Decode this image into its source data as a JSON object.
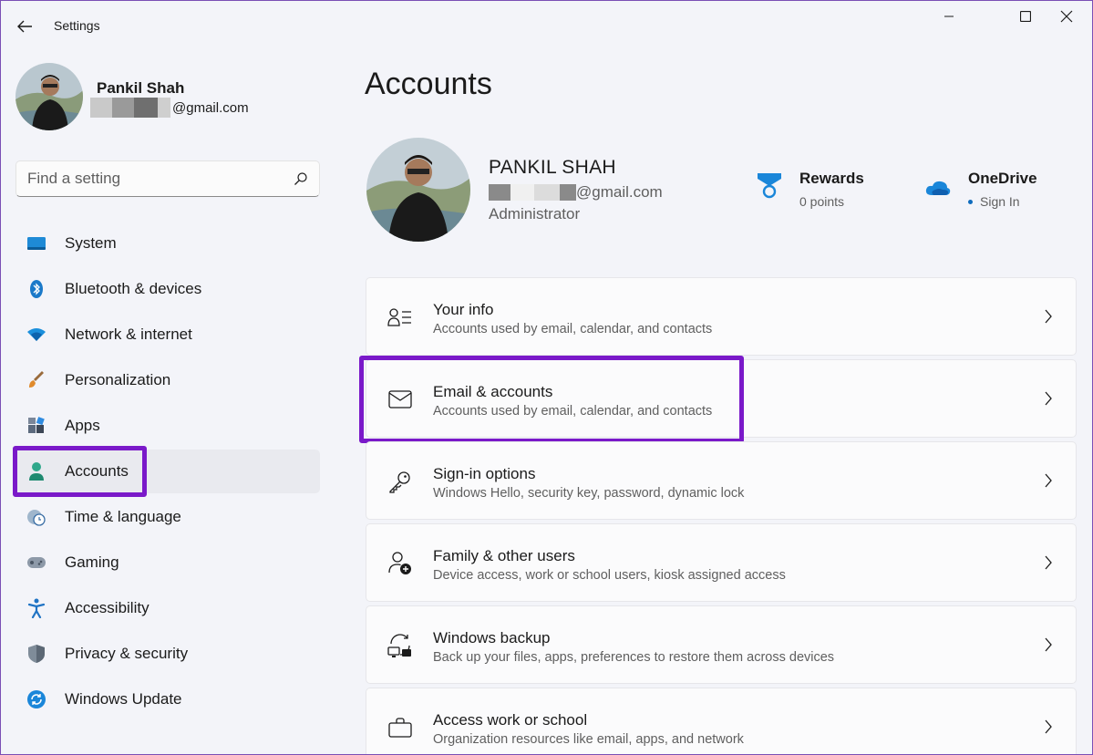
{
  "window": {
    "title": "Settings"
  },
  "profile": {
    "name": "Pankil Shah",
    "email": "@gmail.com"
  },
  "search": {
    "placeholder": "Find a setting"
  },
  "nav": {
    "items": [
      {
        "label": "System",
        "icon": "monitor-icon"
      },
      {
        "label": "Bluetooth & devices",
        "icon": "bluetooth-icon"
      },
      {
        "label": "Network & internet",
        "icon": "wifi-icon"
      },
      {
        "label": "Personalization",
        "icon": "paintbrush-icon"
      },
      {
        "label": "Apps",
        "icon": "apps-icon"
      },
      {
        "label": "Accounts",
        "icon": "person-icon",
        "active": true
      },
      {
        "label": "Time & language",
        "icon": "clock-globe-icon"
      },
      {
        "label": "Gaming",
        "icon": "gamepad-icon"
      },
      {
        "label": "Accessibility",
        "icon": "accessibility-icon"
      },
      {
        "label": "Privacy & security",
        "icon": "shield-icon"
      },
      {
        "label": "Windows Update",
        "icon": "update-icon"
      }
    ]
  },
  "main": {
    "title": "Accounts",
    "account": {
      "name": "PANKIL SHAH",
      "email": "@gmail.com",
      "role": "Administrator"
    },
    "rewards": {
      "title": "Rewards",
      "subtitle": "0 points"
    },
    "onedrive": {
      "title": "OneDrive",
      "subtitle": "Sign In"
    },
    "cards": [
      {
        "title": "Your info",
        "subtitle": "Accounts used by email, calendar, and contacts",
        "icon": "person-list-icon"
      },
      {
        "title": "Email & accounts",
        "subtitle": "Accounts used by email, calendar, and contacts",
        "icon": "mail-icon"
      },
      {
        "title": "Sign-in options",
        "subtitle": "Windows Hello, security key, password, dynamic lock",
        "icon": "key-icon"
      },
      {
        "title": "Family & other users",
        "subtitle": "Device access, work or school users, kiosk assigned access",
        "icon": "add-person-icon"
      },
      {
        "title": "Windows backup",
        "subtitle": "Back up your files, apps, preferences to restore them across devices",
        "icon": "backup-icon"
      },
      {
        "title": "Access work or school",
        "subtitle": "Organization resources like email, apps, and network",
        "icon": "briefcase-icon"
      }
    ]
  },
  "colors": {
    "accent": "#0f6cbd",
    "highlight": "#7a19c9"
  }
}
